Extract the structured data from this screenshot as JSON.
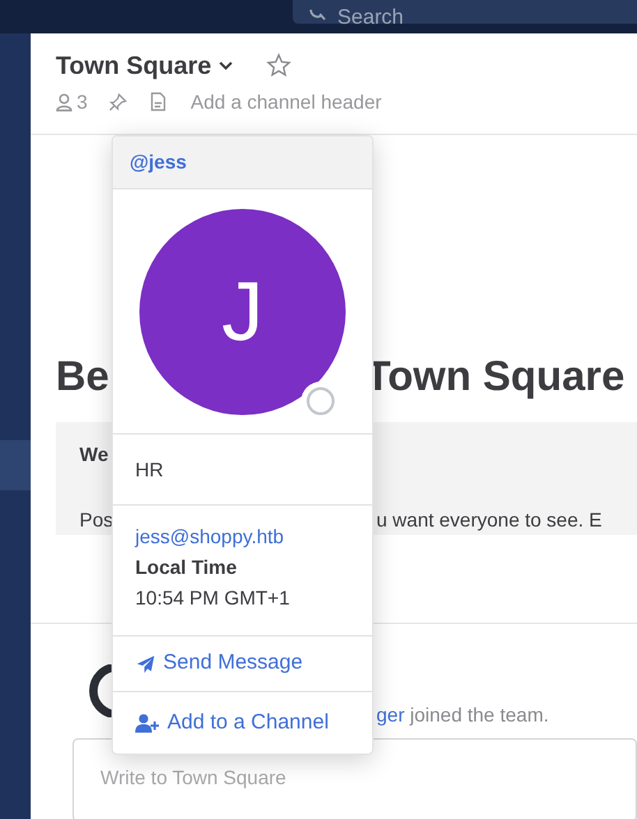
{
  "top_bar": {
    "search": {
      "placeholder": "Search"
    }
  },
  "sidebar": {
    "items": [
      {
        "selected": true
      }
    ]
  },
  "channel_header": {
    "title": "Town Square",
    "favorite": false,
    "member_count": "3",
    "header_placeholder": "Add a channel header"
  },
  "intro": {
    "heading_start": "Be",
    "heading_end": "Town Square",
    "welcome_title_start": "We",
    "welcome_text_start": "Pos",
    "welcome_text_end": "u want everyone to see. E"
  },
  "messages": [
    {
      "author_fragment": "ger",
      "text": "joined the team."
    }
  ],
  "composer": {
    "placeholder": "Write to Town Square"
  },
  "profile_popover": {
    "username": "@jess",
    "avatar_letter": "J",
    "online": false,
    "position": "HR",
    "email": "jess@shoppy.htb",
    "local_time_label": "Local Time",
    "local_time": "10:54 PM GMT+1",
    "actions": [
      {
        "kind": "message",
        "label": "Send Message"
      },
      {
        "kind": "add_channel",
        "label": "Add to a Channel"
      }
    ]
  }
}
